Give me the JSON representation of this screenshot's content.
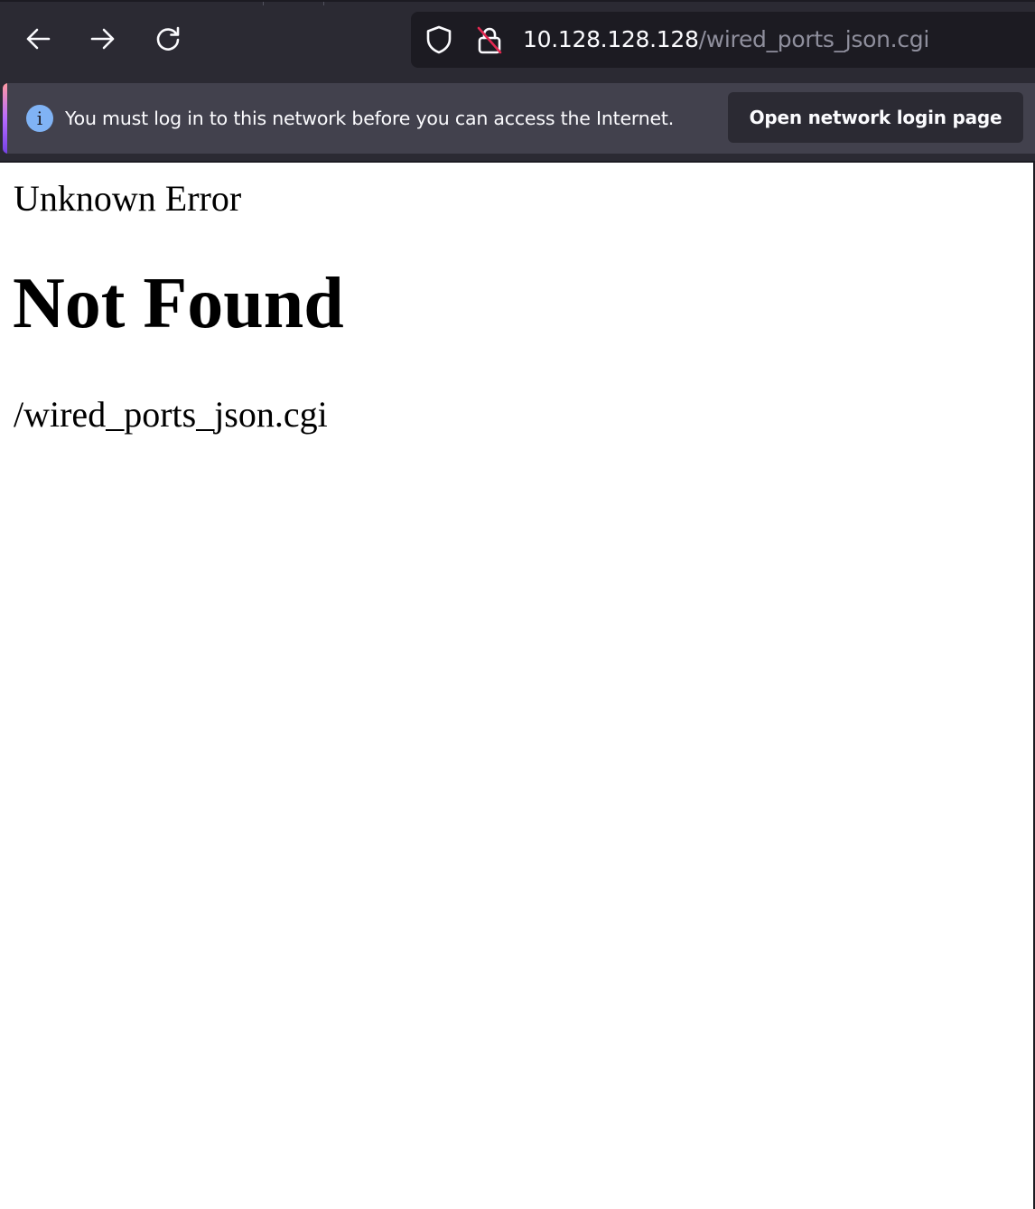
{
  "browser": {
    "nav": {
      "back_icon": "arrow-left-icon",
      "forward_icon": "arrow-right-icon",
      "reload_icon": "reload-icon"
    },
    "urlbar": {
      "tracking_icon": "shield-icon",
      "security_icon": "insecure-lock-icon",
      "host": "10.128.128.128",
      "path": "/wired_ports_json.cgi"
    }
  },
  "notification": {
    "icon": "info-icon",
    "icon_glyph": "i",
    "message": "You must log in to this network before you can access the Internet.",
    "button_label": "Open network login page"
  },
  "page": {
    "title": "Unknown Error",
    "heading": "Not Found",
    "path": "/wired_ports_json.cgi"
  },
  "colors": {
    "toolbar_bg": "#2b2a33",
    "urlbar_bg": "#1c1b22",
    "notification_bg": "#42414d",
    "info_blue": "#80b3f5",
    "insecure_red": "#e22850"
  }
}
